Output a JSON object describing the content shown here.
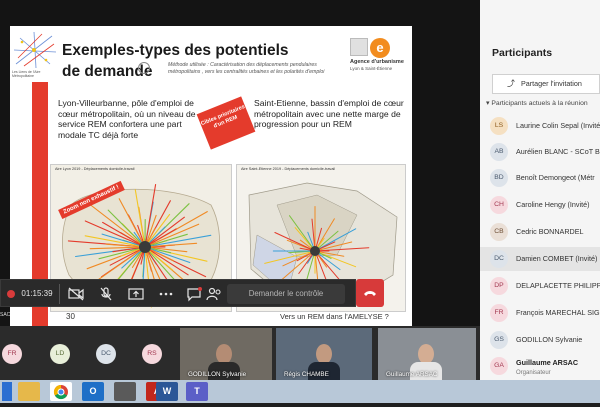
{
  "slide": {
    "title": "Exemples-types des potentiels de demande",
    "method": "Méthode utilisée : Caractérisation des déplacements pendulaires métropolitains , vers les centralités urbaines et les polarités d'emploi",
    "logo_caption": "Les Liens de l'Aire Métropolitaine",
    "agency_name": "Agence d'urbanisme",
    "agency_sub": "Lyon & Saint-Étienne",
    "left_text": "Lyon-Villeurbanne, pôle d'emploi de cœur métropolitain, où un niveau de service REM conforterа une part modale TC déjà forte",
    "right_text": "Saint-Etienne, bassin d'emploi de cœur métropolitain avec une nette marge de progression pour un REM",
    "callout": "Cibles prioritaires d'un REM",
    "map_tag": "Zoom non exhaustif !",
    "map_left_header": "Aire Lyon 2019 - Déplacements domicile-travail",
    "map_right_header": "Aire Saint-Etienne 2019 - Déplacements domicile-travail",
    "page_number": "30",
    "footer": "Vers un REM dans l'AMELYSE ?"
  },
  "toolbar": {
    "timer": "01:15:39",
    "control_label": "Demander le contrôle",
    "icons": [
      "video-off-icon",
      "mic-off-icon",
      "share-screen-icon",
      "more-icon",
      "chat-icon",
      "participants-icon"
    ]
  },
  "tile_label": "SAC",
  "participants_panel": {
    "title": "Participants",
    "share_button": "Partager l'invitation",
    "section_header": "Participants actuels à la réunion",
    "people": [
      {
        "initials": "LS",
        "name": "Laurine Colin Sepal (Invité)",
        "color": "#f5e0c2",
        "text": "#8a5a1c"
      },
      {
        "initials": "AB",
        "name": "Aurélien BLANC - SCoT Bu",
        "color": "#dde3ea",
        "text": "#4a5a6e"
      },
      {
        "initials": "BD",
        "name": "Benoît Demongeot (Métr",
        "color": "#dde3ea",
        "text": "#4a5a6e"
      },
      {
        "initials": "CH",
        "name": "Caroline Hengy (Invité)",
        "color": "#f6d9de",
        "text": "#a33a52"
      },
      {
        "initials": "CB",
        "name": "Cedric BONNARDEL",
        "color": "#eadfd6",
        "text": "#6e4f36"
      },
      {
        "initials": "DC",
        "name": "Damien COMBET (Invité)",
        "color": "#dde3ea",
        "text": "#4a5a6e"
      },
      {
        "initials": "DP",
        "name": "DELAPLACETTE PHILIPPE",
        "color": "#f6d9de",
        "text": "#a33a52"
      },
      {
        "initials": "FR",
        "name": "François MARECHAL SIG",
        "color": "#f6d9de",
        "text": "#a33a52"
      },
      {
        "initials": "GS",
        "name": "GODILLON Sylvanie",
        "color": "#dde3ea",
        "text": "#4a5a6e"
      },
      {
        "initials": "GA",
        "name": "Guillaume ARSAC",
        "role": "Organisateur",
        "color": "#f6d9de",
        "text": "#a33a52"
      }
    ]
  },
  "tiles": {
    "circles": [
      {
        "initials": "FR",
        "color": "#f6d9de",
        "text": "#a33a52"
      },
      {
        "initials": "LD",
        "color": "#e8efd9",
        "text": "#5a6e3a"
      },
      {
        "initials": "DC",
        "color": "#dde3ea",
        "text": "#4a5a6e"
      },
      {
        "initials": "RS",
        "color": "#f6d9de",
        "text": "#a33a52"
      }
    ],
    "videos": [
      {
        "name": "GODILLON Sylvanie"
      },
      {
        "name": "Régis CHAMBE"
      },
      {
        "name": "Guillaume ARSAC"
      }
    ]
  },
  "taskbar": {
    "apps": [
      {
        "name": "file-explorer-icon",
        "label": "",
        "color": "#e6b84a"
      },
      {
        "name": "chrome-icon",
        "label": "",
        "color": "#3aa757"
      },
      {
        "name": "outlook-icon",
        "label": "O",
        "color": "#1e6fc7"
      },
      {
        "name": "calculator-icon",
        "label": "",
        "color": "#5a5a5a"
      },
      {
        "name": "acrobat-icon",
        "label": "A",
        "color": "#c2271d"
      },
      {
        "name": "word-icon",
        "label": "W",
        "color": "#2b5797"
      },
      {
        "name": "teams-icon",
        "label": "T",
        "color": "#5b5fc7"
      }
    ]
  }
}
